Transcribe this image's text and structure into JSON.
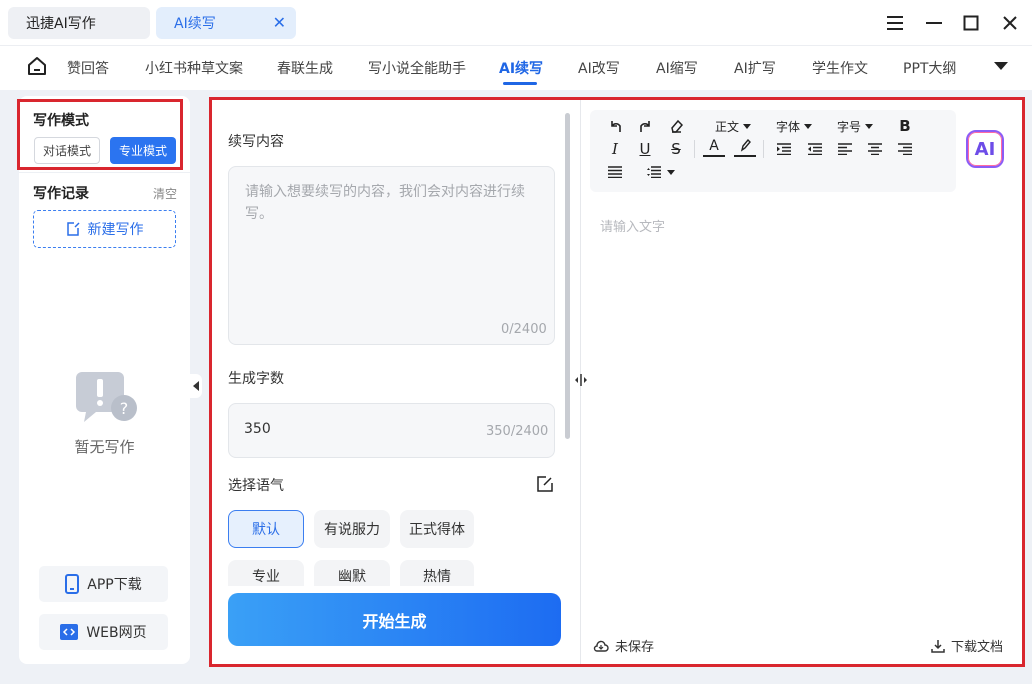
{
  "titlebar": {
    "tabs": [
      {
        "label": "迅捷AI写作"
      },
      {
        "label": "AI续写",
        "close": "✕"
      }
    ]
  },
  "nav": {
    "items": [
      "赞回答",
      "小红书种草文案",
      "春联生成",
      "写小说全能助手",
      "AI续写",
      "AI改写",
      "AI缩写",
      "AI扩写",
      "学生作文",
      "PPT大纲"
    ],
    "active": "AI续写"
  },
  "sidebar": {
    "mode_title": "写作模式",
    "mode_dialog": "对话模式",
    "mode_pro": "专业模式",
    "record_title": "写作记录",
    "clear": "清空",
    "new_writing": "新建写作",
    "empty_text": "暂无写作",
    "app_download": "APP下载",
    "web": "WEB网页"
  },
  "form": {
    "content_label": "续写内容",
    "content_placeholder": "请输入想要续写的内容，我们会对内容进行续写。",
    "content_counter": "0/2400",
    "wordcount_label": "生成字数",
    "wordcount_value": "350",
    "wordcount_counter": "350/2400",
    "tone_label": "选择语气",
    "tones": [
      "默认",
      "有说服力",
      "正式得体",
      "专业",
      "幽默",
      "热情"
    ],
    "tone_selected": "默认",
    "generate": "开始生成"
  },
  "editor": {
    "toolbar": {
      "paragraph": "正文",
      "font": "字体",
      "size": "字号",
      "bold": "B",
      "italic": "I",
      "underline": "U",
      "strike": "S",
      "font_color": "A"
    },
    "ai_logo": "AI",
    "placeholder": "请输入文字",
    "unsaved": "未保存",
    "download": "下载文档"
  },
  "colors": {
    "accent": "#1f66e5",
    "highlight_box": "#d9262e"
  }
}
